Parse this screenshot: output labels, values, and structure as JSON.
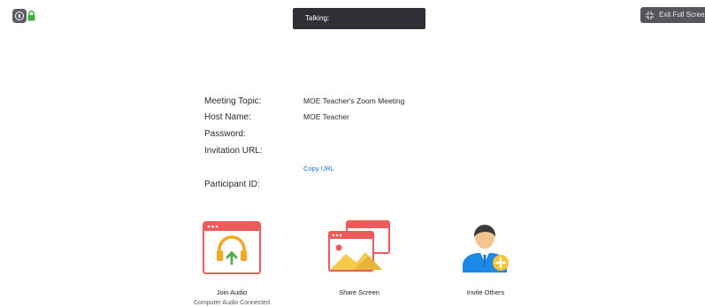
{
  "status": {
    "talking_label": "Talking:"
  },
  "toolbar": {
    "exit_full_screen_label": "Exit Full Screen"
  },
  "meeting": {
    "topic_label": "Meeting Topic:",
    "topic_value": "MOE Teacher's Zoom Meeting",
    "host_label": "Host Name:",
    "host_value": "MOE Teacher",
    "password_label": "Password:",
    "invitation_label": "Invitation URL:",
    "copy_url_label": "Copy URL",
    "participant_label": "Participant ID:"
  },
  "actions": {
    "join_audio_label": "Join Audio",
    "join_audio_sub": "Computer Audio Connected",
    "share_screen_label": "Share Screen",
    "invite_others_label": "Invite Others"
  },
  "colors": {
    "accent_red": "#ef5b5b",
    "headset_orange": "#f5a623",
    "arrow_green": "#4caf50",
    "link_blue": "#1a73d9",
    "avatar_blue": "#1e88e5",
    "plus_yellow": "#f7c236"
  }
}
